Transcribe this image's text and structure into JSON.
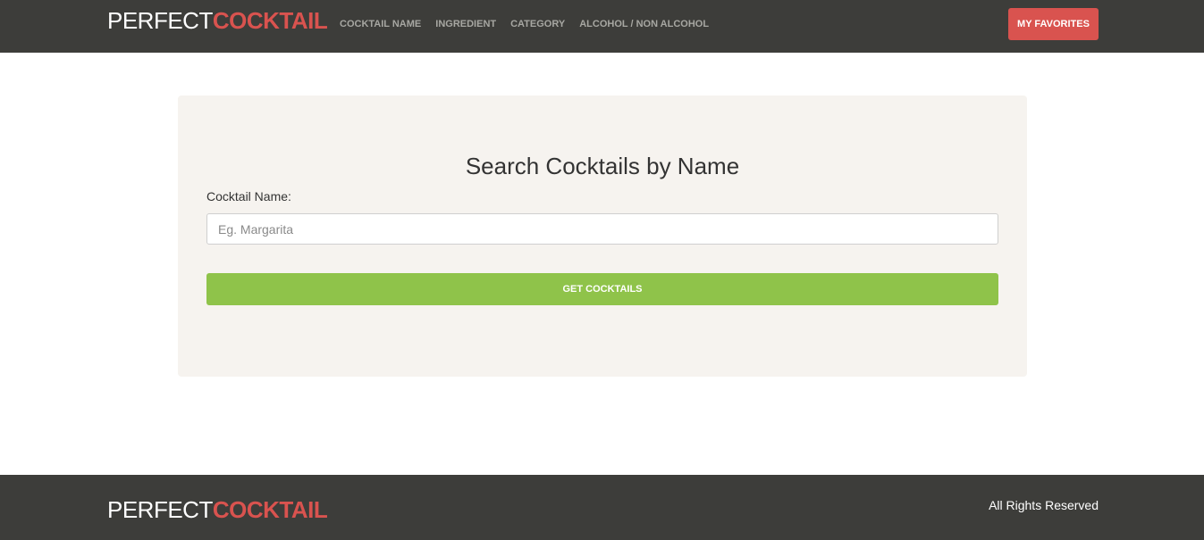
{
  "header": {
    "brand_light": "PERFECT",
    "brand_bold": "COCKTAIL",
    "nav": [
      {
        "label": "COCKTAIL NAME"
      },
      {
        "label": "INGREDIENT"
      },
      {
        "label": "CATEGORY"
      },
      {
        "label": "ALCOHOL / NON ALCOHOL"
      }
    ],
    "favorites_label": "MY FAVORITES"
  },
  "search": {
    "title": "Search Cocktails by Name",
    "field_label": "Cocktail Name:",
    "placeholder": "Eg. Margarita",
    "value": "",
    "button_label": "GET COCKTAILS"
  },
  "footer": {
    "brand_light": "PERFECT",
    "brand_bold": "COCKTAIL",
    "rights": "All Rights Reserved"
  },
  "colors": {
    "nav_background": "#3d3d3a",
    "brand_accent": "#d9534f",
    "primary_button": "#8fc34a",
    "card_background": "#f6f3ef"
  }
}
